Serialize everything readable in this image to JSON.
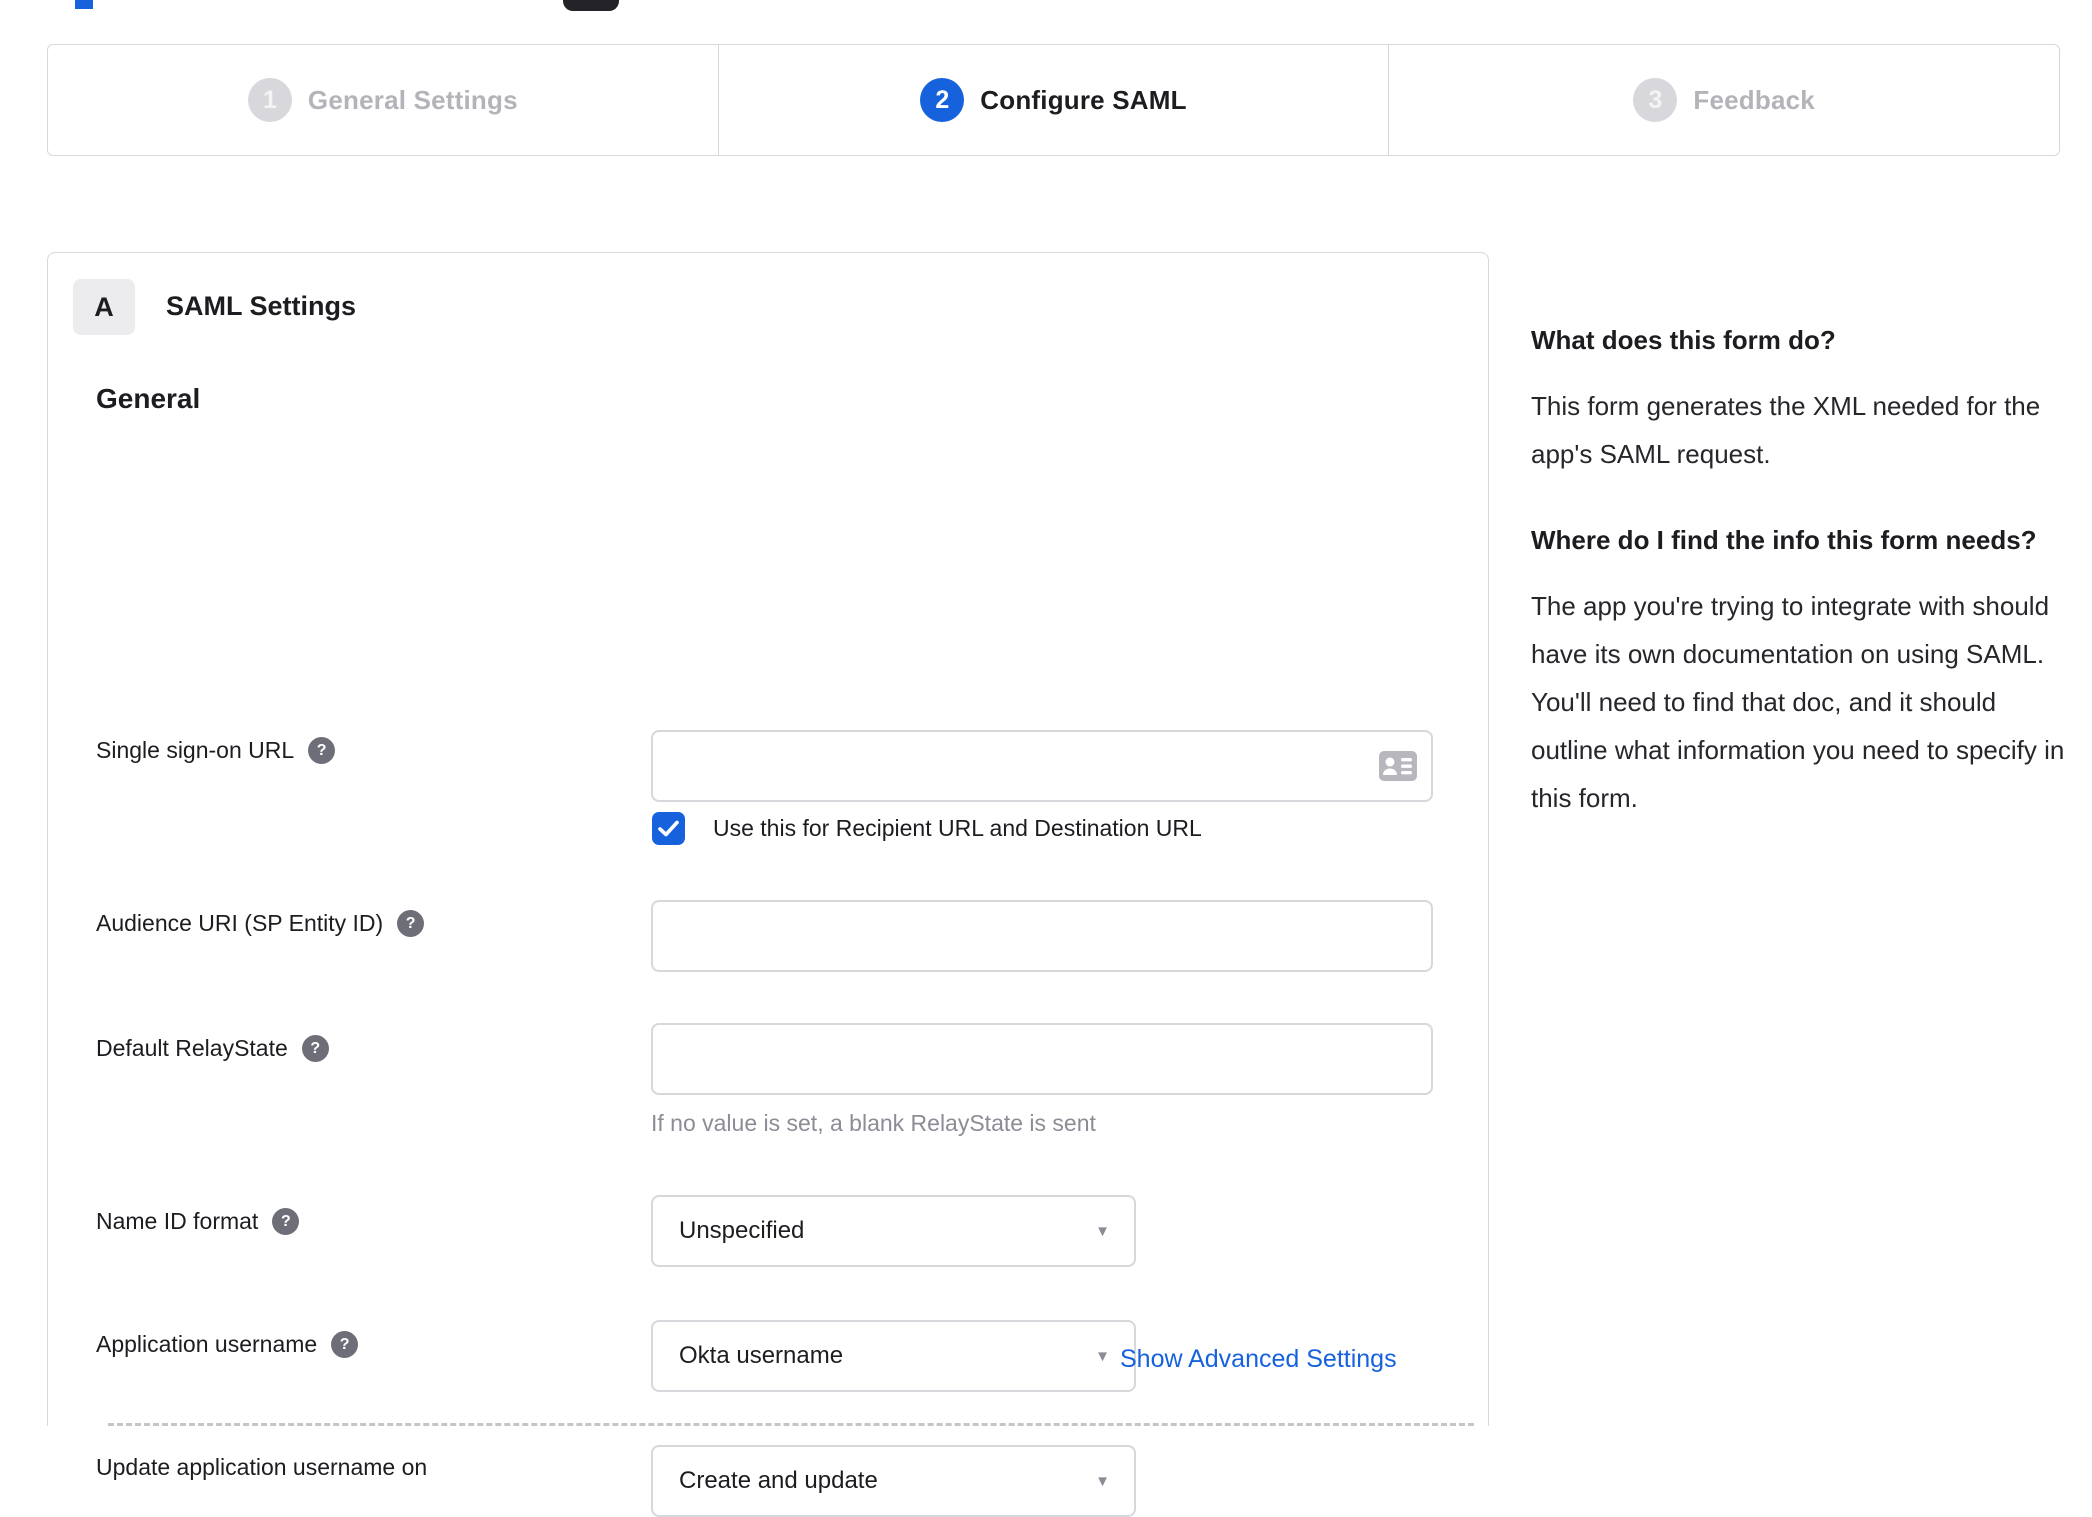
{
  "glyphs": {
    "question": "?",
    "dropdown_arrow": "▼"
  },
  "stepper": {
    "steps": [
      {
        "number": "1",
        "label": "General Settings",
        "state": "inactive"
      },
      {
        "number": "2",
        "label": "Configure SAML",
        "state": "active"
      },
      {
        "number": "3",
        "label": "Feedback",
        "state": "inactive"
      }
    ]
  },
  "panel": {
    "badge": "A",
    "title": "SAML Settings",
    "section_heading": "General",
    "fields": {
      "sso_url": {
        "label": "Single sign-on URL",
        "value": "",
        "checkbox_label": "Use this for Recipient URL and Destination URL",
        "checkbox_checked": true
      },
      "audience_uri": {
        "label": "Audience URI (SP Entity ID)",
        "value": ""
      },
      "relay_state": {
        "label": "Default RelayState",
        "value": "",
        "hint": "If no value is set, a blank RelayState is sent"
      },
      "name_id_format": {
        "label": "Name ID format",
        "value": "Unspecified"
      },
      "app_username": {
        "label": "Application username",
        "value": "Okta username"
      },
      "update_app_username": {
        "label": "Update application username on",
        "value": "Create and update"
      }
    },
    "advanced_link": "Show Advanced Settings"
  },
  "sidebar": {
    "q1_title": "What does this form do?",
    "q1_body": "This form generates the XML needed for the app's SAML request.",
    "q2_title": "Where do I find the info this form needs?",
    "q2_body": "The app you're trying to integrate with should have its own documentation on using SAML. You'll need to find that doc, and it should outline what information you need to specify in this form."
  },
  "colors": {
    "accent_blue": "#1662dd",
    "border_gray": "#d7d7dc",
    "inactive_gray": "#b3b3ba",
    "text_dark": "#1d1d21",
    "hint_gray": "#8c8c96"
  }
}
